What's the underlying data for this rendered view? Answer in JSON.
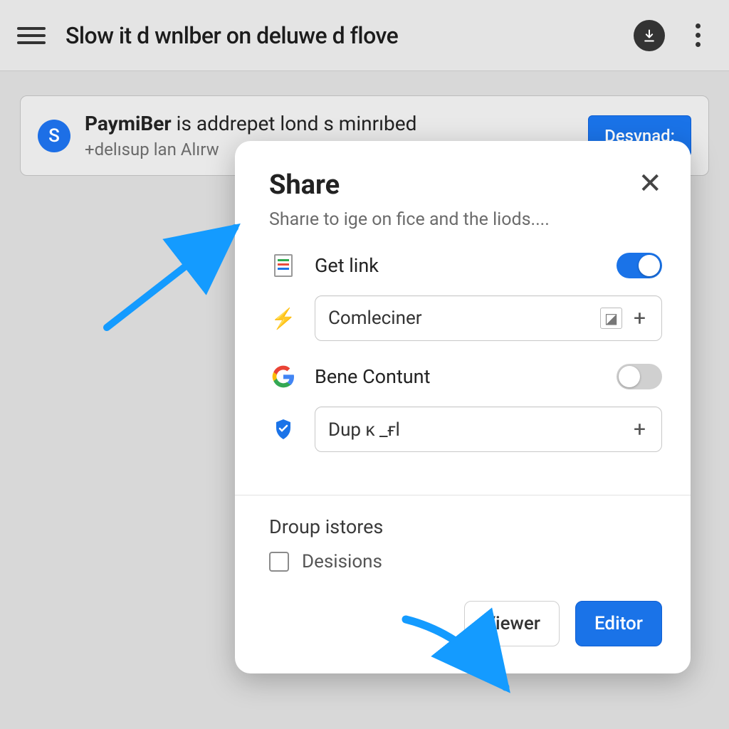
{
  "colors": {
    "primary": "#1a73e8"
  },
  "appbar": {
    "title": "Slow it d wnlber on deluwe d flove"
  },
  "card": {
    "avatar_letter": "S",
    "line1_bold": "PaymiBer",
    "line1_rest": " is addrepet lond s minrıbed",
    "line2": "+delısup lan Alırw",
    "button": "Desvnad:"
  },
  "modal": {
    "title": "Share",
    "subtitle": "Sharıe to ige on fice and the liods....",
    "getlink_label": "Get link",
    "input1_value": "Comleciner",
    "bene_label": "Bene Contunt",
    "input2_value": "Dup ᴋ _ғl",
    "section": "Droup istores",
    "checkbox_label": "Desisions",
    "btn_viewer": "Viewer",
    "btn_editor": "Editor"
  }
}
